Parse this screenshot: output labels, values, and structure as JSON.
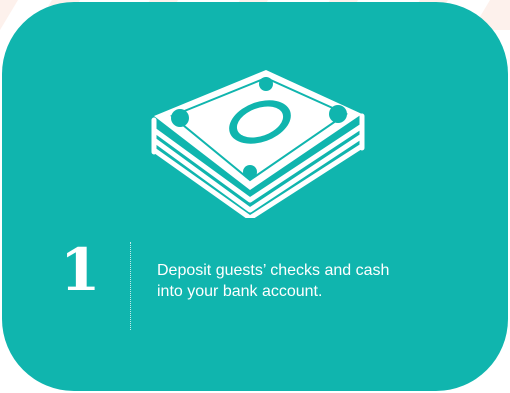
{
  "colors": {
    "card_background": "#10b5ae",
    "foreground": "#ffffff",
    "page_background": "#ffffff",
    "stripe_tint": "#fdf1ec"
  },
  "illustration": {
    "icon": "money-stack-icon"
  },
  "step": {
    "number": "1",
    "line1": "Deposit guests’ checks and cash",
    "line2": "into your bank account."
  }
}
